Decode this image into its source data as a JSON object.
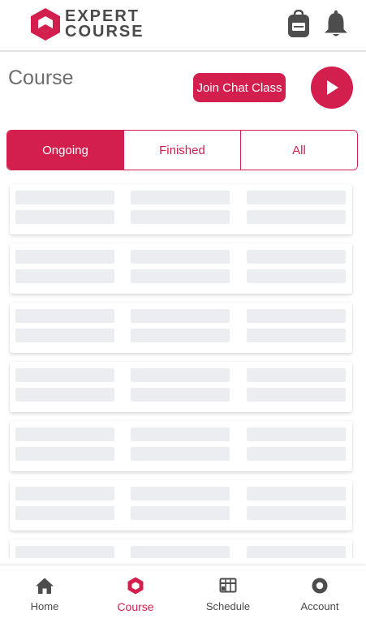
{
  "brand": {
    "line1": "EXPERT",
    "line2": "COURSE",
    "accent_color": "#d31f4e"
  },
  "header": {
    "icons": [
      "backpack-icon",
      "bell-icon"
    ]
  },
  "page": {
    "title": "Course",
    "join_chat_label": "Join Chat Class",
    "play_icon": "play-icon"
  },
  "tabs": [
    {
      "label": "Ongoing",
      "active": true
    },
    {
      "label": "Finished",
      "active": false
    },
    {
      "label": "All",
      "active": false
    }
  ],
  "course_list": {
    "state": "loading",
    "skeleton_cards_visible": 7
  },
  "bottom_nav": [
    {
      "label": "Home",
      "icon": "home-icon",
      "active": false
    },
    {
      "label": "Course",
      "icon": "hexagon-icon",
      "active": true
    },
    {
      "label": "Schedule",
      "icon": "schedule-icon",
      "active": false
    },
    {
      "label": "Account",
      "icon": "account-icon",
      "active": false
    }
  ]
}
